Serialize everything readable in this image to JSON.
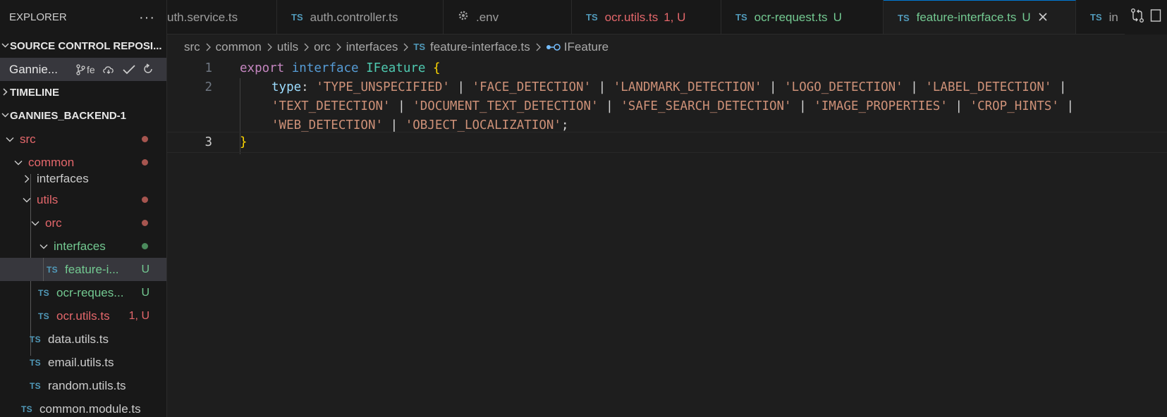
{
  "sidebar": {
    "title": "EXPLORER",
    "more_label": "···",
    "sections": {
      "source_control": "SOURCE CONTROL REPOSI...",
      "timeline": "TIMELINE",
      "workspace": "GANNIES_BACKEND-1"
    },
    "repo": {
      "name": "Gannie...",
      "branch": "fe"
    },
    "tree": [
      {
        "label": "src",
        "status": ""
      },
      {
        "label": "common",
        "status": ""
      },
      {
        "label": "interfaces",
        "status": ""
      },
      {
        "label": "utils",
        "status": ""
      },
      {
        "label": "orc",
        "status": ""
      },
      {
        "label": "interfaces",
        "status": ""
      },
      {
        "label": "feature-i...",
        "status": "U",
        "badge": "TS"
      },
      {
        "label": "ocr-reques...",
        "status": "U",
        "badge": "TS"
      },
      {
        "label": "ocr.utils.ts",
        "status": "1, U",
        "badge": "TS"
      },
      {
        "label": "data.utils.ts",
        "status": "",
        "badge": "TS"
      },
      {
        "label": "email.utils.ts",
        "status": "",
        "badge": "TS"
      },
      {
        "label": "random.utils.ts",
        "status": "",
        "badge": "TS"
      },
      {
        "label": "common.module.ts",
        "status": "",
        "badge": "TS"
      }
    ]
  },
  "tabs": [
    {
      "label": "uth.service.ts",
      "badge": "",
      "status": ""
    },
    {
      "label": "auth.controller.ts",
      "badge": "TS",
      "status": ""
    },
    {
      "label": ".env",
      "badge": "",
      "status": ""
    },
    {
      "label": "ocr.utils.ts",
      "badge": "TS",
      "status": "1, U"
    },
    {
      "label": "ocr-request.ts",
      "badge": "TS",
      "status": "U"
    },
    {
      "label": "feature-interface.ts",
      "badge": "TS",
      "status": "U"
    },
    {
      "label": "in",
      "badge": "TS",
      "status": ""
    }
  ],
  "breadcrumb": {
    "items": [
      "src",
      "common",
      "utils",
      "orc",
      "interfaces"
    ],
    "file": "feature-interface.ts",
    "file_badge": "TS",
    "symbol": "IFeature"
  },
  "editor": {
    "line_numbers": [
      "1",
      "2",
      "",
      "",
      "3"
    ],
    "l1": {
      "export": "export",
      "interface": "interface",
      "name": "IFeature",
      "brace": "{"
    },
    "l2": {
      "prop": "type",
      "colon": ":",
      "v1": "'TYPE_UNSPECIFIED'",
      "v2": "'FACE_DETECTION'",
      "v3": "'LANDMARK_DETECTION'",
      "v4": "'LOGO_DETECTION'",
      "v5": "'LABEL_DETECTION'",
      "v6": "'TEXT_DETECTION'",
      "v7": "'DOCUMENT_TEXT_DETECTION'",
      "v8": "'SAFE_SEARCH_DETECTION'",
      "v9": "'IMAGE_PROPERTIES'",
      "v10": "'CROP_HINTS'",
      "v11": "'WEB_DETECTION'",
      "v12": "'OBJECT_LOCALIZATION'",
      "pipe": "|",
      "semi": ";"
    },
    "l3": {
      "brace": "}"
    }
  },
  "colors": {
    "modified": "#e4676b",
    "untracked": "#73c991",
    "ts_badge": "#519aba",
    "accent": "#0078d4"
  }
}
